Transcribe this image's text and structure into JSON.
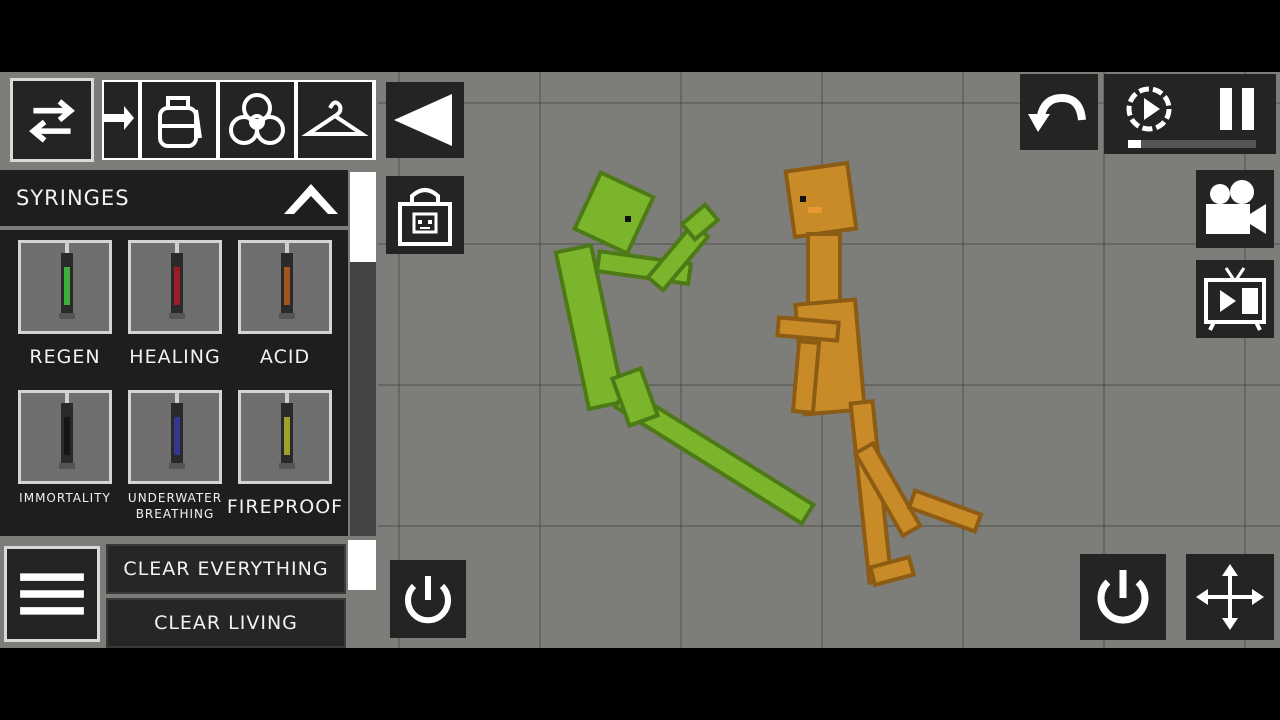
{
  "category": {
    "title": "SYRINGES"
  },
  "syringes": [
    {
      "label": "REGEN",
      "color": "#3fae3f"
    },
    {
      "label": "HEALING",
      "color": "#9a1c25"
    },
    {
      "label": "ACID",
      "color": "#a4551f"
    },
    {
      "label": "IMMORTALITY",
      "color": "#161616"
    },
    {
      "label": "UNDERWATER\nBREATHING",
      "color": "#35368f"
    },
    {
      "label": "FIREPROOF",
      "color": "#9ea12a"
    }
  ],
  "bottom": {
    "clear_everything": "CLEAR EVERYTHING",
    "clear_living": "CLEAR LIVING"
  },
  "time_progress": 0.1,
  "colors": {
    "melon": "#7bb52b",
    "melon_dark": "#4d7a16",
    "orange": "#c98a28",
    "orange_dark": "#8c5c14",
    "ui_dark": "#242424"
  }
}
